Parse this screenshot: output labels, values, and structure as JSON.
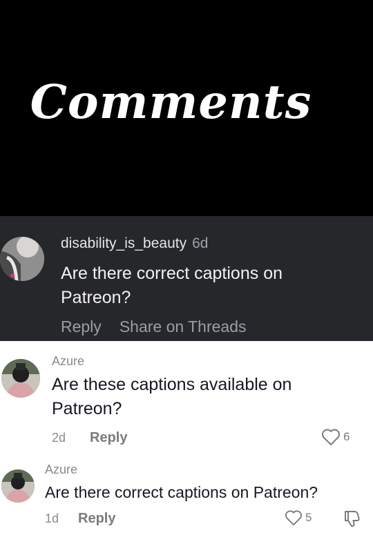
{
  "header": {
    "title": "Comments"
  },
  "dark_comment": {
    "username": "disability_is_beauty",
    "time": "6d",
    "text": "Are there correct captions on Patreon?",
    "actions": {
      "reply": "Reply",
      "share": "Share on Threads"
    }
  },
  "comments": [
    {
      "username": "Azure",
      "text": "Are these captions available on Patreon?",
      "time": "2d",
      "reply": "Reply",
      "likes": "6"
    },
    {
      "username": "Azure",
      "text": "Are there correct captions on Patreon?",
      "time": "1d",
      "reply": "Reply",
      "likes": "5"
    }
  ],
  "colors": {
    "header_bg": "#000000",
    "dark_bg": "#26272b",
    "muted": "#8a8a8a",
    "text_dark": "#161823"
  },
  "icons": [
    "heart-outline-icon",
    "dislike-icon"
  ]
}
